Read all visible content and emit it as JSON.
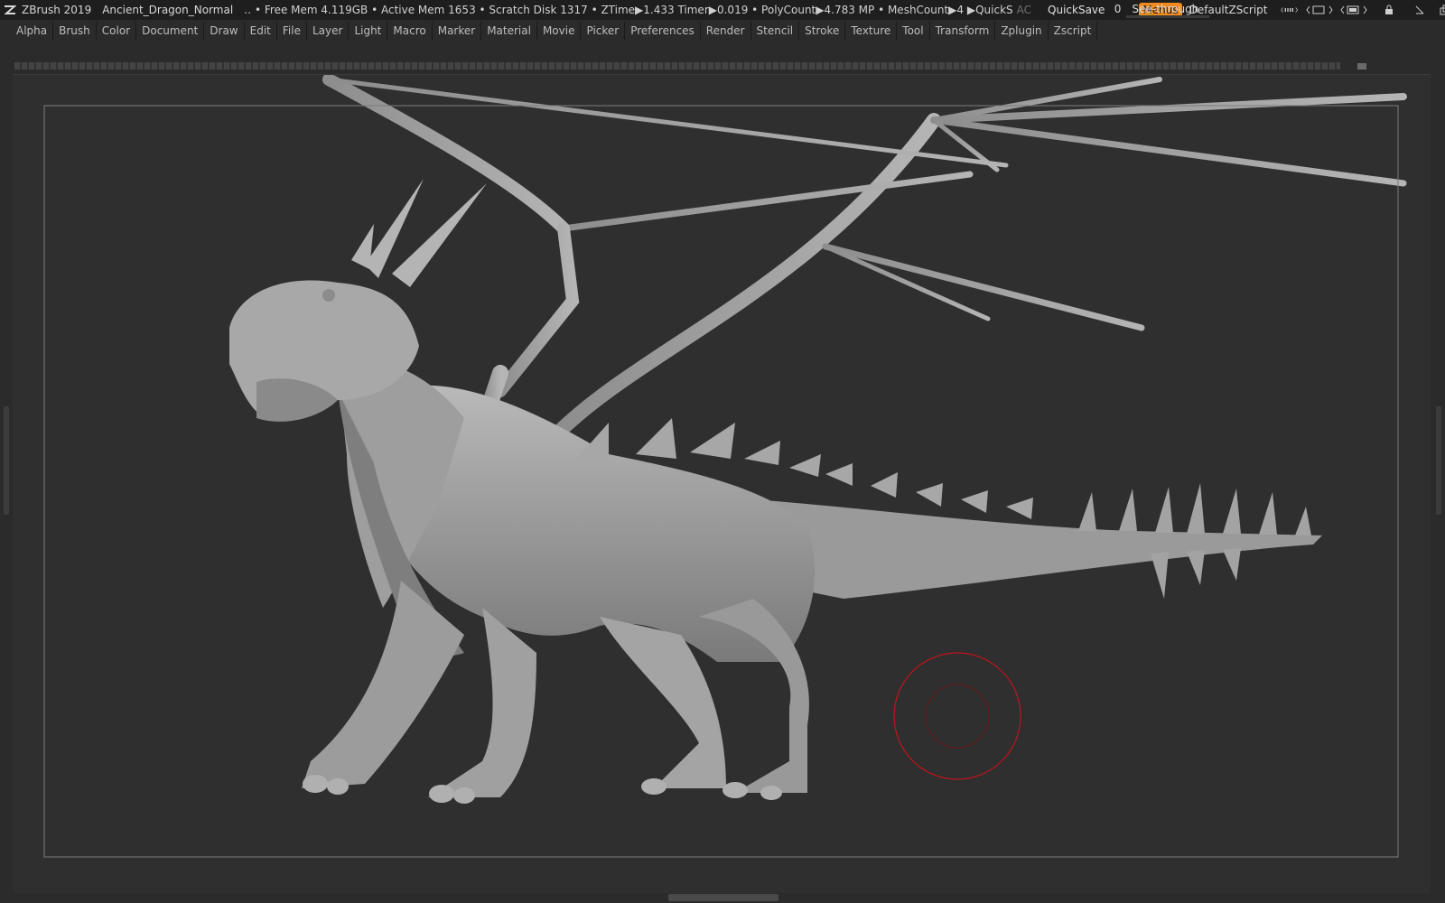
{
  "titlebar": {
    "app": "ZBrush 2019",
    "project": "Ancient_Dragon_Normal",
    "stats": "‥ • Free Mem 4.119GB • Active Mem 1653 • Scratch Disk 1317 •  ZTime▶1.433 Timer▶0.019 • PolyCount▶4.783 MP  • MeshCount▶4  ▶QuickS",
    "ac": "AC",
    "quicksave": "QuickSave",
    "see_through_label": "See-through",
    "see_through_value": "0",
    "see_through_level": 0.1,
    "menus_label": "Menus",
    "script_name": "DefaultZScript",
    "accent_color": "#f08a1e"
  },
  "menubar": {
    "items": [
      "Alpha",
      "Brush",
      "Color",
      "Document",
      "Draw",
      "Edit",
      "File",
      "Layer",
      "Light",
      "Macro",
      "Marker",
      "Material",
      "Movie",
      "Picker",
      "Preferences",
      "Render",
      "Stencil",
      "Stroke",
      "Texture",
      "Tool",
      "Transform",
      "Zplugin",
      "Zscript"
    ]
  },
  "canvas": {
    "model": "dragon-sculpt",
    "brush_cursor_color": "#c0141c"
  }
}
